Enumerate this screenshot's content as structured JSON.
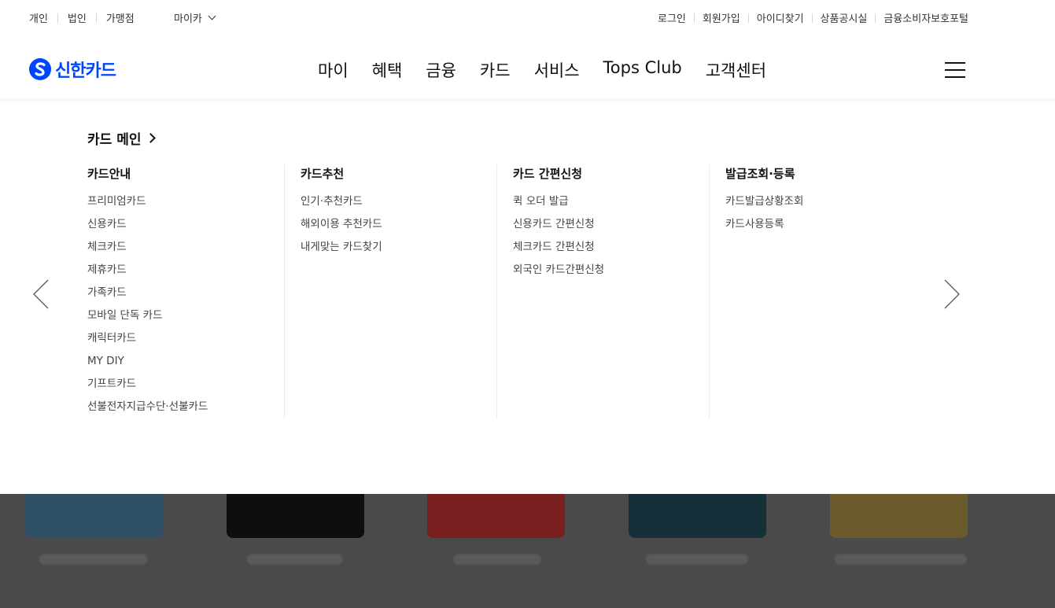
{
  "util": {
    "left": [
      "개인",
      "법인",
      "가맹점"
    ],
    "myca": "마이카",
    "right": [
      "로그인",
      "회원가입",
      "아이디찾기",
      "상품공시실",
      "금융소비자보호포털"
    ]
  },
  "brand": {
    "name": "신한카드",
    "color": "#0046ff"
  },
  "nav": [
    "마이",
    "혜택",
    "금융",
    "카드",
    "서비스",
    "Tops Club",
    "고객센터"
  ],
  "mega": {
    "main_link": "카드 메인",
    "columns": [
      {
        "title": "카드안내",
        "items": [
          "프리미엄카드",
          "신용카드",
          "체크카드",
          "제휴카드",
          "가족카드",
          "모바일 단독 카드",
          "캐릭터카드",
          "MY DIY",
          "기프트카드",
          "선불전자지급수단·선불카드"
        ]
      },
      {
        "title": "카드추천",
        "items": [
          "인기·추천카드",
          "해외이용 추천카드",
          "내게맞는 카드찾기"
        ]
      },
      {
        "title": "카드 간편신청",
        "items": [
          "퀵 오더 발급",
          "신용카드 간편신청",
          "체크카드 간편신청",
          "외국인 카드간편신청"
        ]
      },
      {
        "title": "발급조회·등록",
        "items": [
          "카드발급상황조회",
          "카드사용등록"
        ]
      }
    ]
  },
  "icons": {
    "prev": "chevron-left-icon",
    "next": "chevron-right-icon",
    "menu": "hamburger-icon",
    "dropdown": "chevron-down-icon"
  }
}
